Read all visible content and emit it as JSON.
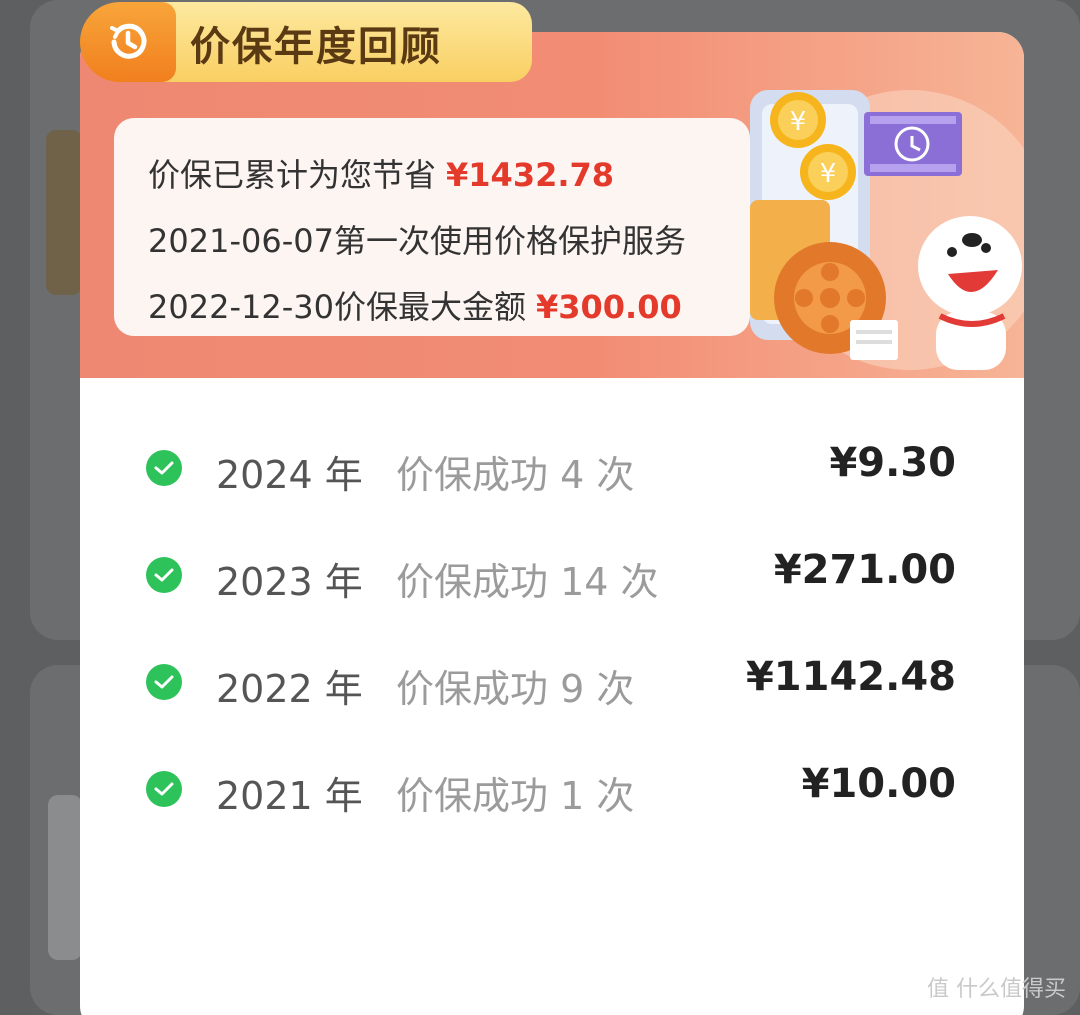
{
  "header": {
    "title": "价保年度回顾",
    "history_icon": "history-icon"
  },
  "summary": {
    "saved_label": "价保已累计为您节省",
    "saved_amount": "¥1432.78",
    "first_use": "2021-06-07第一次使用价格保护服务",
    "max_label": "2022-12-30价保最大金额",
    "max_amount": "¥300.00"
  },
  "years": [
    {
      "year": "2024 年",
      "count": "价保成功 4 次",
      "amount": "¥9.30"
    },
    {
      "year": "2023 年",
      "count": "价保成功 14 次",
      "amount": "¥271.00"
    },
    {
      "year": "2022 年",
      "count": "价保成功 9 次",
      "amount": "¥1142.48"
    },
    {
      "year": "2021 年",
      "count": "价保成功 1 次",
      "amount": "¥10.00"
    }
  ],
  "watermark": "值 什么值得买",
  "colors": {
    "header_start": "#ee8872",
    "header_end": "#f7b496",
    "amount_red": "#e33a2c",
    "check_green": "#2ec25a",
    "badge_gold": "#f9cf62",
    "badge_orange": "#f17f1e"
  }
}
